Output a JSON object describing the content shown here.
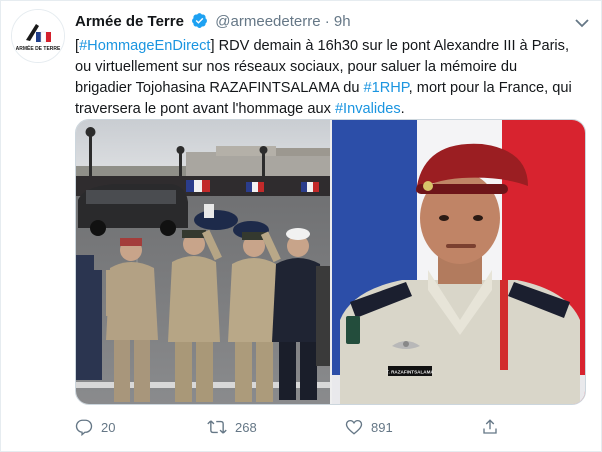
{
  "tweet": {
    "author_name": "Armée de Terre",
    "handle": "@armeedeterre",
    "separator": "·",
    "time": "9h",
    "avatar_label": "ARMÉE DE TERRE",
    "text_lines": [
      [
        {
          "t": "[",
          "link": false
        },
        {
          "t": "#HommageEnDirect",
          "link": true
        },
        {
          "t": "] RDV demain à 16h30 sur le pont Alexandre III à Paris,",
          "link": false
        }
      ],
      [
        {
          "t": "ou virtuellement sur nos réseaux sociaux, pour saluer la mémoire du",
          "link": false
        }
      ],
      [
        {
          "t": "brigadier Tojohasina RAZAFINTSALAMA du ",
          "link": false
        },
        {
          "t": "#1RHP",
          "link": true
        },
        {
          "t": ", mort pour la France, qui",
          "link": false
        }
      ],
      [
        {
          "t": "traversera le pont avant l'hommage aux ",
          "link": false
        },
        {
          "t": "#Invalides",
          "link": true
        },
        {
          "t": ".",
          "link": false
        }
      ]
    ],
    "media": {
      "left_photo": "ceremony on Pont Alexandre III with saluting soldiers",
      "right_photo": "portrait of soldier with red beret in front of French flag",
      "name_tag": "T. RAZAFINTSALAMA"
    },
    "actions": {
      "reply_count": "20",
      "retweet_count": "268",
      "like_count": "891"
    },
    "colors": {
      "link": "#1b95e0",
      "secondary": "#657786",
      "verified": "#1da1f2"
    },
    "icons": [
      "verified-badge-icon",
      "chevron-down-icon",
      "reply-icon",
      "retweet-icon",
      "like-icon",
      "share-icon"
    ]
  }
}
